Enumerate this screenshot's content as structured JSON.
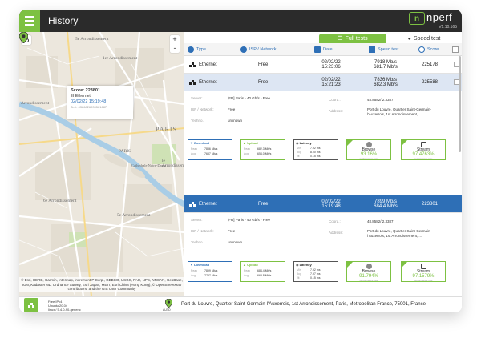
{
  "app": {
    "title": "History",
    "logo_text": "nperf",
    "logo_mark": "n",
    "version": "V1.10.165"
  },
  "tabs": [
    {
      "label": "Full tests",
      "active": true,
      "icon": "clipboard-icon"
    },
    {
      "label": "Speed test",
      "active": false,
      "icon": "speedometer-icon"
    }
  ],
  "columns": [
    {
      "label": "Type",
      "icon": "globe-icon"
    },
    {
      "label": "ISP / Network",
      "icon": "globe-icon"
    },
    {
      "label": "Date",
      "icon": "calendar-icon"
    },
    {
      "label": "Speed test",
      "icon": "hourglass-icon"
    },
    {
      "label": "Score",
      "icon": "search-icon"
    }
  ],
  "rows": [
    {
      "type": "Ethernet",
      "isp": "Free",
      "date": "02/02/22",
      "time": "15:23:06",
      "down": "7918 Mb/s",
      "up": "681.7 Mb/s",
      "score": "225178",
      "style": "normal"
    },
    {
      "type": "Ethernet",
      "isp": "Free",
      "date": "02/02/22",
      "time": "15:21:23",
      "down": "7836 Mb/s",
      "up": "682.3 Mb/s",
      "score": "225588",
      "style": "alt"
    },
    {
      "type": "Ethernet",
      "isp": "Free",
      "date": "02/02/22",
      "time": "15:19:48",
      "down": "7899 Mb/s",
      "up": "684.4 Mb/s",
      "score": "223801",
      "style": "sel"
    }
  ],
  "details": [
    {
      "server_label": "Server:",
      "server": "[FR] Paris - 40 Gb/s - Free",
      "isp_label": "ISP / Network:",
      "isp": "Free",
      "techno_label": "Techno.:",
      "techno": "unknown",
      "coord_label": "Coord.:",
      "coord": "48.8582/ 2.3387",
      "address_label": "Address:",
      "address1": "Port du Louvre, Quartier Saint-Germain-",
      "address2": "l'Auxerrois, 1st Arrondissement, ...",
      "download": {
        "title": "Download",
        "peak_label": "Peak",
        "peak": "7836 Mb/s",
        "avg_label": "Avg",
        "avg": "7687 Mb/s"
      },
      "upload": {
        "title": "Upload",
        "peak_label": "Peak",
        "peak": "682.3 Mb/s",
        "avg_label": "Avg",
        "avg": "654.0 Mb/s"
      },
      "latency": {
        "title": "Latency",
        "min_label": "Min",
        "min": "7.92 ms",
        "avg_label": "Avg",
        "avg": "8.00 ms",
        "jit_label": "Jit",
        "jit": "0.15 ms"
      },
      "browse": {
        "name": "Browse",
        "pct": "93.16%",
        "sub": "performance rate"
      },
      "stream": {
        "name": "Stream",
        "pct": "97.4763%",
        "sub": "performance rate"
      }
    },
    {
      "server_label": "Server:",
      "server": "[FR] Paris - 40 Gb/s - Free",
      "isp_label": "ISP / Network:",
      "isp": "Free",
      "techno_label": "Techno.:",
      "techno": "unknown",
      "coord_label": "Coord.:",
      "coord": "48.8582/ 2.3387",
      "address_label": "Address:",
      "address1": "Port du Louvre, Quartier Saint-Germain-",
      "address2": "l'Auxerrois, 1st Arrondissement, ...",
      "download": {
        "title": "Download",
        "peak_label": "Peak",
        "peak": "7899 Mb/s",
        "avg_label": "Avg",
        "avg": "7737 Mb/s"
      },
      "upload": {
        "title": "Upload",
        "peak_label": "Peak",
        "peak": "684.4 Mb/s",
        "avg_label": "Avg",
        "avg": "663.8 Mb/s"
      },
      "latency": {
        "title": "Latency",
        "min_label": "Min",
        "min": "7.92 ms",
        "avg_label": "Avg",
        "avg": "7.97 ms",
        "jit_label": "Jit",
        "jit": "0.15 ms"
      },
      "browse": {
        "name": "Browse",
        "pct": "91.794%",
        "sub": "performance rate"
      },
      "stream": {
        "name": "Stream",
        "pct": "97.1579%",
        "sub": "performance rate"
      }
    }
  ],
  "map": {
    "labels": [
      "5e Arrondissement",
      "1er Arrondissement",
      "Arrondissement",
      "PARIS",
      "PARIS",
      "Cathédrale Notre-Dame",
      "6e Arrondissement",
      "5e Arrondissement",
      "le Arrondissement"
    ],
    "popup": {
      "score": "Score: 223801",
      "type": "Ethernet",
      "date": "02/02/22 15:19:48",
      "id": "Test: 4386826039561687"
    },
    "attribution": "© Esri, HERE, Garmin, Intermap, increment P Corp., GEBCO, USGS, FAO, NPS, NRCAN, GeoBase, IGN, Kadaster NL, Ordnance Survey, Esri Japan, METI, Esri China (Hong Kong), © OpenStreetMap contributors, and the GIS User Community",
    "zoom_in": "+",
    "zoom_out": "-"
  },
  "footer": {
    "network": "Free IPv4",
    "os": "Ubuntu 20.04",
    "kernel": "linux / 5.4.0-90-generic",
    "auto": "AUTO",
    "address": "Port du Louvre, Quartier Saint-Germain-l'Auxerrois, 1st Arrondissement, Paris, Metropolitan France, 75001, France"
  },
  "colors": {
    "accent": "#7dc142",
    "primary": "#2e6fb6",
    "topbar": "#2b2b2b"
  }
}
